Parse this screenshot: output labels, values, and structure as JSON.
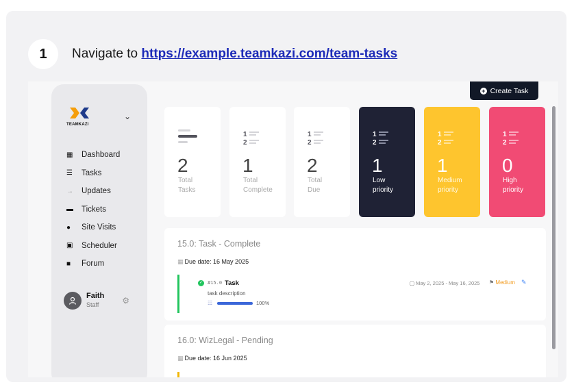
{
  "step": {
    "number": "1",
    "text": "Navigate to ",
    "link": "https://example.teamkazi.com/team-tasks"
  },
  "sidebar": {
    "logo_text": "TEAMKAZI",
    "items": [
      {
        "label": "Dashboard",
        "icon": "dashboard-icon"
      },
      {
        "label": "Tasks",
        "icon": "tasks-icon"
      },
      {
        "label": "Updates",
        "icon": "updates-icon"
      },
      {
        "label": "Tickets",
        "icon": "tickets-icon"
      },
      {
        "label": "Site Visits",
        "icon": "location-icon"
      },
      {
        "label": "Scheduler",
        "icon": "calendar-icon"
      },
      {
        "label": "Forum",
        "icon": "chat-icon"
      }
    ],
    "user": {
      "name": "Faith",
      "role": "Staff"
    }
  },
  "header": {
    "create_label": "Create Task"
  },
  "stats": [
    {
      "value": "2",
      "label1": "Total",
      "label2": "Tasks"
    },
    {
      "value": "1",
      "label1": "Total",
      "label2": "Complete"
    },
    {
      "value": "2",
      "label1": "Total",
      "label2": "Due"
    },
    {
      "value": "1",
      "label1": "Low",
      "label2": "priority"
    },
    {
      "value": "1",
      "label1": "Medium",
      "label2": "priority"
    },
    {
      "value": "0",
      "label1": "High",
      "label2": "priority"
    }
  ],
  "panels": [
    {
      "title": "15.0: Task - Complete",
      "due": "Due date: 16 May 2025",
      "task": {
        "code": "#15.0",
        "name": "Task",
        "description": "task description",
        "progress": 100,
        "progress_label": "100%",
        "dates": "May 2, 2025 - May 16, 2025",
        "priority": "Medium"
      }
    },
    {
      "title": "16.0: WizLegal - Pending",
      "due": "Due date: 16 Jun 2025"
    }
  ],
  "colors": {
    "dark_card": "#1f2235",
    "medium_card": "#fec52e",
    "high_card": "#f14b74",
    "complete_accent": "#22c55e",
    "pending_accent": "#f2b705",
    "priority_medium": "#f29a1c"
  }
}
